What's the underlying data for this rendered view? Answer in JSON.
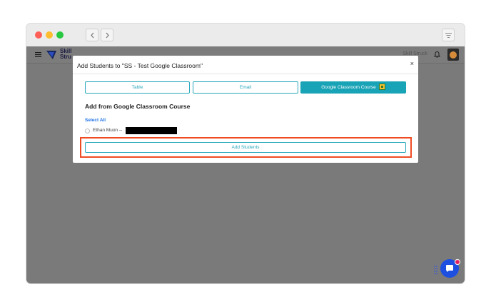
{
  "app": {
    "logo_text_line1": "Skill",
    "logo_text_line2": "Stru",
    "user_name": "Skill Struck"
  },
  "modal": {
    "title": "Add Students to \"SS - Test Google Classroom\"",
    "close_label": "×",
    "tabs": [
      {
        "label": "Table",
        "active": false
      },
      {
        "label": "Email",
        "active": false
      },
      {
        "label": "Google Classroom Course",
        "active": true
      }
    ],
    "section_title": "Add from Google Classroom Course",
    "select_all": "Select All",
    "students": [
      {
        "label": "Ethan Muon --",
        "checked": false
      }
    ],
    "add_button": "Add Students"
  },
  "colors": {
    "accent": "#19a3b6",
    "link": "#1e73e8",
    "highlight": "#ef4b22",
    "chat": "#1d4fe0"
  }
}
